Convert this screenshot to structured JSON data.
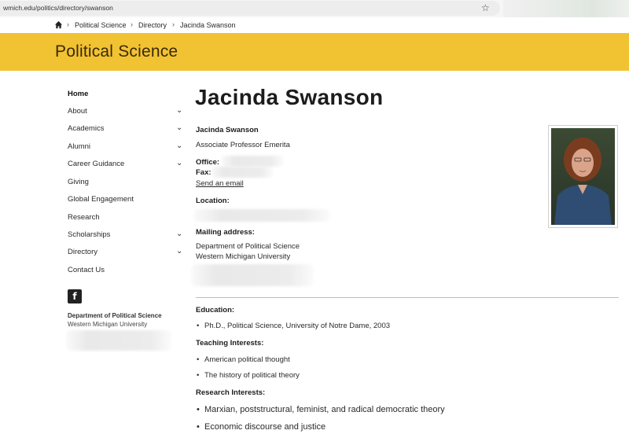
{
  "browser": {
    "url": "wmich.edu/politics/directory/swanson",
    "bookmark_icon": "star-icon"
  },
  "breadcrumb": {
    "home_icon": "home-icon",
    "items": [
      "Political Science",
      "Directory",
      "Jacinda Swanson"
    ],
    "separator": "›"
  },
  "banner": {
    "title": "Political Science",
    "color": "#f1c232"
  },
  "nav": {
    "items": [
      {
        "label": "Home",
        "expandable": false
      },
      {
        "label": "About",
        "expandable": true
      },
      {
        "label": "Academics",
        "expandable": true
      },
      {
        "label": "Alumni",
        "expandable": true
      },
      {
        "label": "Career Guidance",
        "expandable": true
      },
      {
        "label": "Giving",
        "expandable": false
      },
      {
        "label": "Global Engagement",
        "expandable": false
      },
      {
        "label": "Research",
        "expandable": false
      },
      {
        "label": "Scholarships",
        "expandable": true
      },
      {
        "label": "Directory",
        "expandable": true
      },
      {
        "label": "Contact Us",
        "expandable": false
      }
    ],
    "chevron": "⌄",
    "facebook_icon": "f",
    "department_name": "Department of Political Science",
    "university": "Western Michigan University"
  },
  "profile": {
    "heading": "Jacinda Swanson",
    "name": "Jacinda Swanson",
    "position": "Associate Professor Emerita",
    "office_label": "Office:",
    "fax_label": "Fax:",
    "email_link": "Send an email",
    "location_label": "Location:",
    "mailing_label": "Mailing address:",
    "mailing_line1": "Department of Political Science",
    "mailing_line2": "Western Michigan University"
  },
  "education": {
    "label": "Education:",
    "items": [
      "Ph.D., Political Science, University of Notre Dame, 2003"
    ]
  },
  "teaching": {
    "label": "Teaching Interests:",
    "items": [
      "American political thought",
      "The history of political theory"
    ]
  },
  "research": {
    "label": "Research Interests:",
    "items": [
      "Marxian, poststructural, feminist, and radical democratic theory",
      "Economic discourse and justice"
    ]
  },
  "bullet": "•"
}
